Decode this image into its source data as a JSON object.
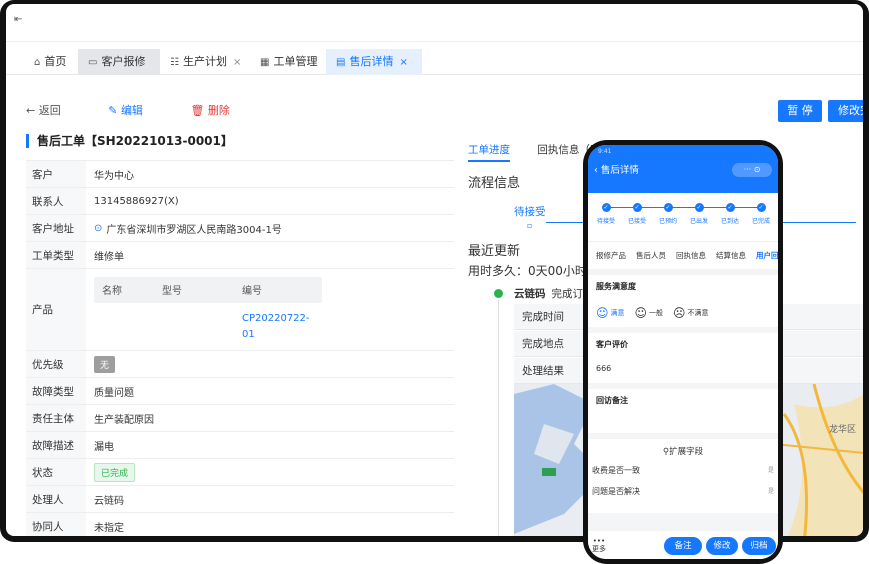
{
  "topbar": {
    "fold_icon": "⇤"
  },
  "tabs": [
    {
      "label": "首页",
      "icon": "home-icon"
    },
    {
      "label": "客户报修",
      "icon": "board-icon"
    },
    {
      "label": "生产计划",
      "icon": "list-icon"
    },
    {
      "label": "工单管理",
      "icon": "grid-icon"
    },
    {
      "label": "售后详情",
      "icon": "doc-icon"
    }
  ],
  "actions": {
    "back": "返回",
    "edit": "编辑",
    "delete": "删除"
  },
  "buttons": {
    "pause": "暂 停",
    "modify": "修改完"
  },
  "order": {
    "title": "售后工单【SH20221013-0001】"
  },
  "fields": {
    "customer": {
      "k": "客户",
      "v": "华为中心"
    },
    "contact": {
      "k": "联系人",
      "v": "13145886927(X)"
    },
    "address": {
      "k": "客户地址",
      "v": "广东省深圳市罗湖区人民南路3004-1号"
    },
    "type": {
      "k": "工单类型",
      "v": "维修单"
    },
    "product": {
      "k": "产品",
      "head_name": "名称",
      "head_model": "型号",
      "head_code": "编号",
      "code": "CP20220722-01"
    },
    "priority": {
      "k": "优先级",
      "v": "无"
    },
    "fault_type": {
      "k": "故障类型",
      "v": "质量问题"
    },
    "resp": {
      "k": "责任主体",
      "v": "生产装配原因"
    },
    "fault_desc": {
      "k": "故障描述",
      "v": "漏电"
    },
    "status": {
      "k": "状态",
      "v": "已完成"
    },
    "handler": {
      "k": "处理人",
      "v": "云链码"
    },
    "assist": {
      "k": "协同人",
      "v": "未指定"
    }
  },
  "right": {
    "tab_progress": "工单进度",
    "tab_receipt": "回执信息（司",
    "flow_title": "流程信息",
    "step_wait": "待接受",
    "recent": "最近更新",
    "used": "用时多久：0天00小时",
    "tl_name": "云链码",
    "tl_action": "完成订单",
    "d1": "完成时间",
    "d2": "完成地点",
    "d3": "处理结果"
  },
  "phone": {
    "status": "9:41",
    "title": "售后详情",
    "caps": "··· ⊙",
    "steps": [
      "待接受",
      "已接受",
      "已预约",
      "已出发",
      "已到达",
      "已完成"
    ],
    "tabs": [
      "报修产品",
      "售后人员",
      "回执信息",
      "结算信息",
      "用户回访"
    ],
    "satisfaction_h": "服务满意度",
    "sat": [
      "满意",
      "一般",
      "不满意"
    ],
    "comment_h": "客户评价",
    "comment": "666",
    "note_h": "回访备注",
    "ext_h": "扩展字段",
    "ext1": "收费是否一致",
    "ext2": "问题是否解决",
    "ext_val": "是",
    "more": "更多",
    "btn_note": "备注",
    "btn_modify": "修改",
    "btn_archive": "归档"
  }
}
